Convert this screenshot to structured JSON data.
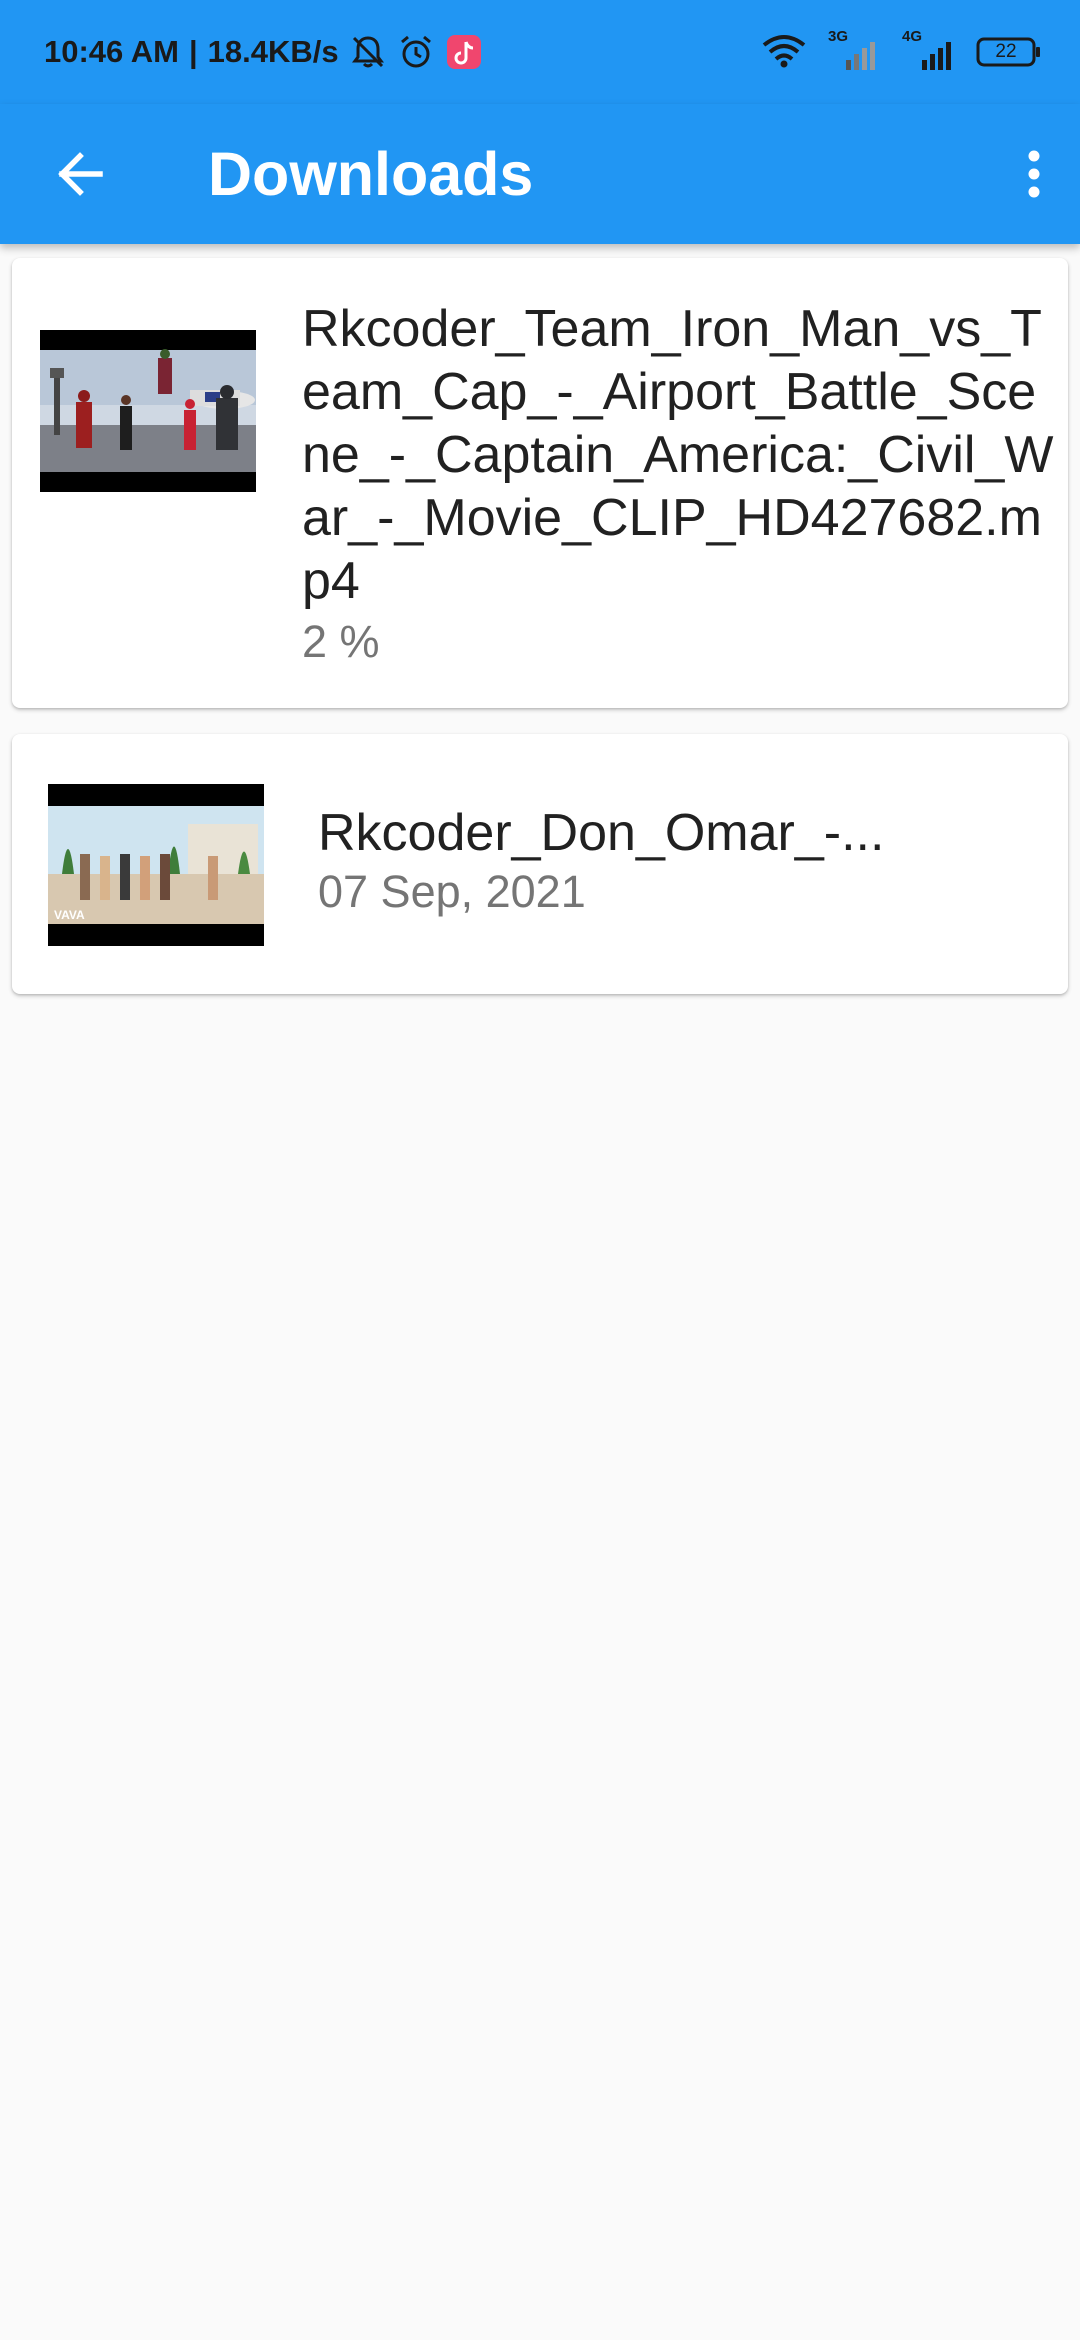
{
  "status_bar": {
    "time": "10:46 AM",
    "separator": "|",
    "speed": "18.4KB/s",
    "network1": "3G",
    "network2": "4G",
    "battery": "22",
    "icons": [
      "mute-bell-icon",
      "alarm-icon",
      "tiktok-icon",
      "wifi-icon",
      "signal-icon",
      "battery-icon"
    ]
  },
  "app_bar": {
    "title": "Downloads",
    "back_icon": "arrow-back-icon",
    "menu_icon": "more-vert-icon"
  },
  "downloads": [
    {
      "name": "Rkcoder_Team_Iron_Man_vs_Team_Cap_-_Airport_Battle_Scene_-_Captain_America:_Civil_War_-_Movie_CLIP_HD427682.mp4",
      "subtitle": "2 %"
    },
    {
      "name": "Rkcoder_Don_Omar_-...",
      "subtitle": "07 Sep, 2021",
      "watermark": "VAVA"
    }
  ],
  "colors": {
    "primary": "#2196f3",
    "background": "#fafafa",
    "card": "#ffffff",
    "text_primary": "#212121",
    "text_secondary": "#757575"
  }
}
